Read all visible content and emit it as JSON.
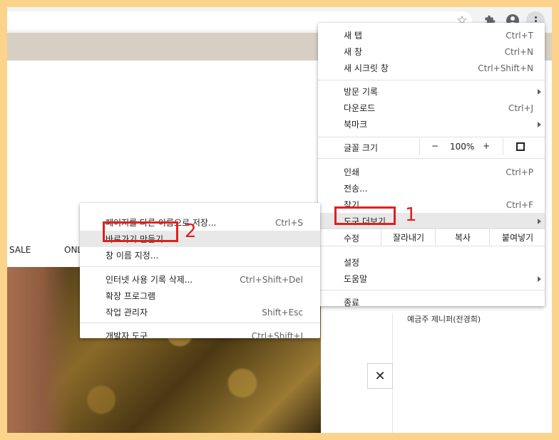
{
  "page": {
    "nav_sale": "SALE",
    "nav_only": "ONLY",
    "side_text": "예금주  제니퍼(전경희)",
    "close_symbol": "✕"
  },
  "toolbar": {
    "icons": [
      "star-icon",
      "extension-icon",
      "profile-icon",
      "more-menu-icon"
    ]
  },
  "main_menu": {
    "new_tab": {
      "label": "새 탭",
      "shortcut": "Ctrl+T"
    },
    "new_window": {
      "label": "새 창",
      "shortcut": "Ctrl+N"
    },
    "incognito": {
      "label": "새 시크릿 창",
      "shortcut": "Ctrl+Shift+N"
    },
    "history": {
      "label": "방문 기록"
    },
    "downloads": {
      "label": "다운로드",
      "shortcut": "Ctrl+J"
    },
    "bookmarks": {
      "label": "북마크"
    },
    "zoom": {
      "label": "글꼴 크기",
      "minus": "−",
      "value": "100%",
      "plus": "+"
    },
    "print": {
      "label": "인쇄",
      "shortcut": "Ctrl+P"
    },
    "cast": {
      "label": "전송..."
    },
    "find": {
      "label": "찾기...",
      "shortcut": "Ctrl+F"
    },
    "more_tools": {
      "label": "도구 더보기"
    },
    "edit": {
      "label": "수정",
      "cut": "잘라내기",
      "copy": "복사",
      "paste": "붙여넣기"
    },
    "settings": {
      "label": "설정"
    },
    "help": {
      "label": "도움말"
    },
    "exit": {
      "label": "종료"
    }
  },
  "sub_menu": {
    "save_page": {
      "label": "페이지를 다른 이름으로 저장...",
      "shortcut": "Ctrl+S"
    },
    "create_shortcut": {
      "label": "바로가기 만들기..."
    },
    "name_window": {
      "label": "창 이름 지정..."
    },
    "clear_data": {
      "label": "인터넷 사용 기록 삭제...",
      "shortcut": "Ctrl+Shift+Del"
    },
    "extensions": {
      "label": "확장 프로그램"
    },
    "task_manager": {
      "label": "작업 관리자",
      "shortcut": "Shift+Esc"
    },
    "dev_tools": {
      "label": "개발자 도구",
      "shortcut": "Ctrl+Shift+I"
    }
  },
  "annotations": {
    "step1": "1",
    "step2": "2",
    "color": "#e0201f"
  }
}
